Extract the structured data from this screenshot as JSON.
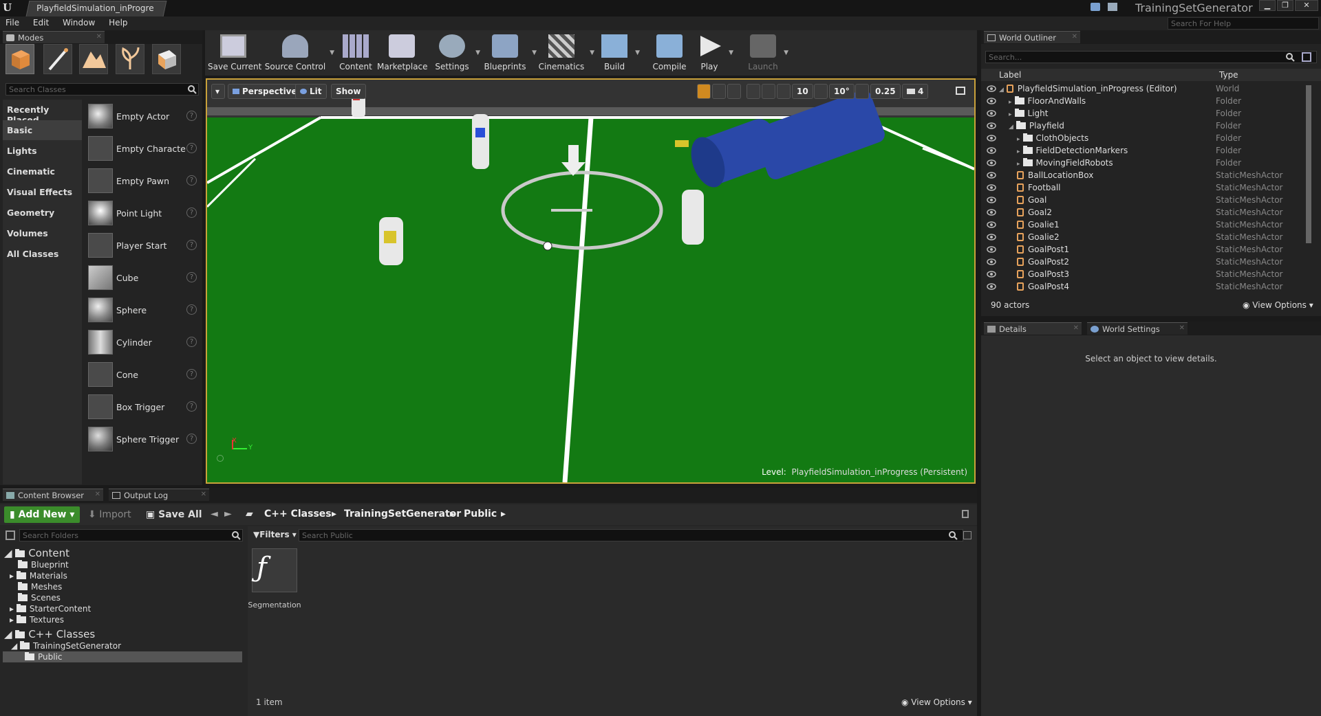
{
  "titlebar": {
    "doc_tab": "PlayfieldSimulation_inProgre",
    "project": "TrainingSetGenerator",
    "min": "▁",
    "max": "❐",
    "close": "✕"
  },
  "menu": [
    "File",
    "Edit",
    "Window",
    "Help"
  ],
  "help_search_placeholder": "Search For Help",
  "modes": {
    "tab": "Modes",
    "search_placeholder": "Search Classes",
    "categories": [
      "Recently Placed",
      "Basic",
      "Lights",
      "Cinematic",
      "Visual Effects",
      "Geometry",
      "Volumes",
      "All Classes"
    ],
    "selected_category": "Basic",
    "items": [
      "Empty Actor",
      "Empty Characte",
      "Empty Pawn",
      "Point Light",
      "Player Start",
      "Cube",
      "Sphere",
      "Cylinder",
      "Cone",
      "Box Trigger",
      "Sphere Trigger"
    ]
  },
  "toolbar": {
    "buttons": [
      "Save Current",
      "Source Control",
      "Content",
      "Marketplace",
      "Settings",
      "Blueprints",
      "Cinematics",
      "Build",
      "Compile",
      "Play",
      "Launch"
    ]
  },
  "viewport": {
    "perspective": "Perspective",
    "lit": "Lit",
    "show": "Show",
    "grid": "10",
    "rot": "10°",
    "scale": "0.25",
    "cam": "4",
    "level_label": "Level:",
    "level_name": "PlayfieldSimulation_inProgress (Persistent)",
    "axis_x": "X",
    "axis_y": "Y"
  },
  "outliner": {
    "tab": "World Outliner",
    "search_placeholder": "Search...",
    "col_label": "Label",
    "col_type": "Type",
    "rows": [
      {
        "name": "PlayfieldSimulation_inProgress (Editor)",
        "type": "World"
      },
      {
        "name": "FloorAndWalls",
        "type": "Folder"
      },
      {
        "name": "Light",
        "type": "Folder"
      },
      {
        "name": "Playfield",
        "type": "Folder"
      },
      {
        "name": "ClothObjects",
        "type": "Folder"
      },
      {
        "name": "FieldDetectionMarkers",
        "type": "Folder"
      },
      {
        "name": "MovingFieldRobots",
        "type": "Folder"
      },
      {
        "name": "BallLocationBox",
        "type": "StaticMeshActor"
      },
      {
        "name": "Football",
        "type": "StaticMeshActor"
      },
      {
        "name": "Goal",
        "type": "StaticMeshActor"
      },
      {
        "name": "Goal2",
        "type": "StaticMeshActor"
      },
      {
        "name": "Goalie1",
        "type": "StaticMeshActor"
      },
      {
        "name": "Goalie2",
        "type": "StaticMeshActor"
      },
      {
        "name": "GoalPost1",
        "type": "StaticMeshActor"
      },
      {
        "name": "GoalPost2",
        "type": "StaticMeshActor"
      },
      {
        "name": "GoalPost3",
        "type": "StaticMeshActor"
      },
      {
        "name": "GoalPost4",
        "type": "StaticMeshActor"
      }
    ],
    "actor_count": "90 actors",
    "view_options": "View Options"
  },
  "details": {
    "tab_details": "Details",
    "tab_world": "World Settings",
    "empty_msg": "Select an object to view details."
  },
  "content_browser": {
    "tab": "Content Browser",
    "tab_output": "Output Log",
    "add_new": "Add New",
    "import": "Import",
    "save_all": "Save All",
    "breadcrumbs": [
      "C++ Classes",
      "TrainingSetGenerator",
      "Public"
    ],
    "folder_search": "Search Folders",
    "filters": "Filters",
    "asset_search": "Search Public",
    "tree": {
      "content": "Content",
      "content_children": [
        "Blueprint",
        "Materials",
        "Meshes",
        "Scenes",
        "StarterContent",
        "Textures"
      ],
      "cpp": "C++ Classes",
      "cpp_child": "TrainingSetGenerator",
      "public": "Public"
    },
    "asset": "Segmentation",
    "item_count": "1 item",
    "view_options": "View Options"
  }
}
